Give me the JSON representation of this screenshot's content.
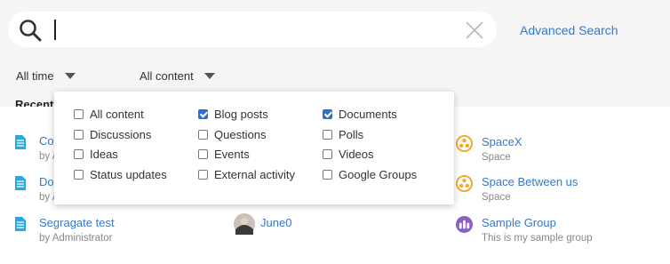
{
  "search": {
    "value": "",
    "placeholder": ""
  },
  "advanced_search": "Advanced Search",
  "filters": {
    "time": "All time",
    "content": "All content"
  },
  "section_title": "Recently",
  "content_options": [
    [
      {
        "label": "All content",
        "checked": false
      },
      {
        "label": "Discussions",
        "checked": false
      },
      {
        "label": "Ideas",
        "checked": false
      },
      {
        "label": "Status updates",
        "checked": false
      }
    ],
    [
      {
        "label": "Blog posts",
        "checked": true
      },
      {
        "label": "Questions",
        "checked": false
      },
      {
        "label": "Events",
        "checked": false
      },
      {
        "label": "External activity",
        "checked": false
      }
    ],
    [
      {
        "label": "Documents",
        "checked": true
      },
      {
        "label": "Polls",
        "checked": false
      },
      {
        "label": "Videos",
        "checked": false
      },
      {
        "label": "Google Groups",
        "checked": false
      }
    ]
  ],
  "content_items": [
    {
      "title": "Co",
      "sub": "by A"
    },
    {
      "title": "Do",
      "sub": "by A"
    },
    {
      "title": "Segragate test",
      "sub": "by Administrator"
    }
  ],
  "people": [
    {
      "title": "June0"
    }
  ],
  "places": [
    {
      "title": "SpaceX",
      "sub": "Space"
    },
    {
      "title": "Space Between us",
      "sub": "Space"
    },
    {
      "title": "Sample Group",
      "sub": "This is my sample group"
    }
  ],
  "colors": {
    "accent": "#3778c7",
    "checkbox": "#2d6fd6",
    "space_icon": "#f5a623",
    "group_icon": "#8b5fc7",
    "doc_icon": "#29a9e0"
  }
}
